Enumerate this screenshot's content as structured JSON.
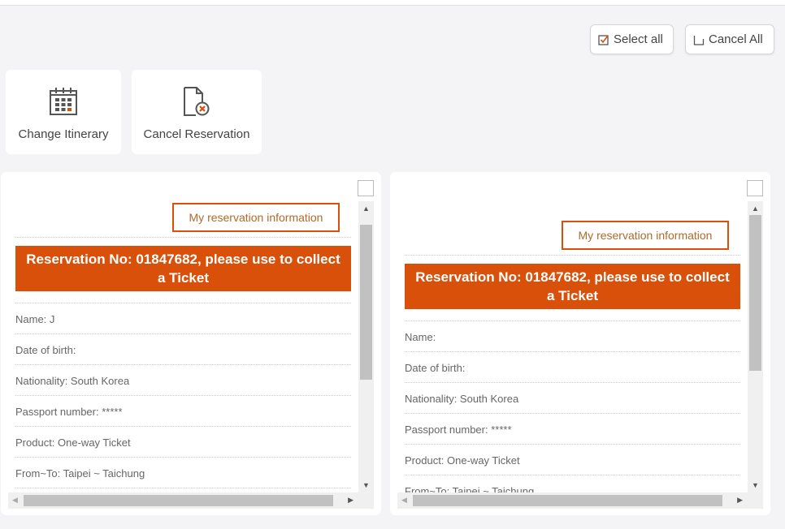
{
  "toolbar": {
    "select_all": "Select all",
    "cancel_all": "Cancel All"
  },
  "actions": [
    {
      "label": "Change Itinerary",
      "icon": "calendar-icon"
    },
    {
      "label": "Cancel Reservation",
      "icon": "document-cancel-icon"
    }
  ],
  "accent_color": "#d9500b",
  "cards": [
    {
      "title": "My reservation information",
      "banner": "Reservation No: 01847682, please use to collect a Ticket",
      "rows": [
        "Name: J",
        "Date of birth:",
        "Nationality: South Korea",
        "Passport number: *****",
        "Product: One-way Ticket",
        "From~To: Taipei ~ Taichung"
      ]
    },
    {
      "title": "My reservation information",
      "banner": "Reservation No: 01847682, please use to collect a Ticket",
      "rows": [
        "Name:",
        "Date of birth:",
        "Nationality: South Korea",
        "Passport number: *****",
        "Product: One-way Ticket",
        "From~To: Taipei ~ Taichung"
      ]
    }
  ]
}
